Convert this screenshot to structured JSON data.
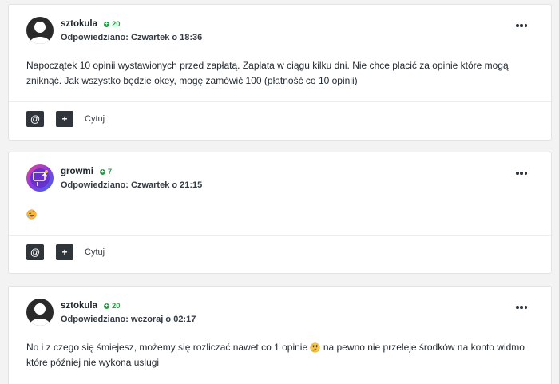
{
  "posts": [
    {
      "author": "sztokula",
      "reputation": "20",
      "meta_label": "Odpowiedziano:",
      "date": "Czwartek o 18:36",
      "content": "Napoczątek 10 opinii wystawionych przed zapłatą. Zapłata w ciągu kilku dni. Nie chce płacić za opinie które mogą zniknąć. Jak wszystko będzie okey, mogę zamówić 100 (płatność co 10 opinii)",
      "avatar_icon": "default-avatar-icon",
      "actions": {
        "mention": "@",
        "multiquote": "+",
        "quote": "Cytuj"
      }
    },
    {
      "author": "growmi",
      "reputation": "7",
      "meta_label": "Odpowiedziano:",
      "date": "Czwartek o 21:15",
      "content": "",
      "emoji": "rolling-laughing-emoji",
      "avatar_icon": "growmi-avatar-icon",
      "actions": {
        "mention": "@",
        "multiquote": "+",
        "quote": "Cytuj"
      }
    },
    {
      "author": "sztokula",
      "reputation": "20",
      "meta_label": "Odpowiedziano:",
      "date": "wczoraj o 02:17",
      "content_before": "No i z czego się śmiejesz, możemy się rozliczać nawet co 1 opinie",
      "content_after": "na pewno nie przeleje środków na konto widmo które później nie wykona uslugi",
      "emoji": "thinking-face-emoji",
      "avatar_icon": "default-avatar-icon"
    }
  ],
  "colors": {
    "reputation": "#2b9a4a",
    "button_bg": "#2f353b",
    "page_bg": "#f3f3f3"
  }
}
